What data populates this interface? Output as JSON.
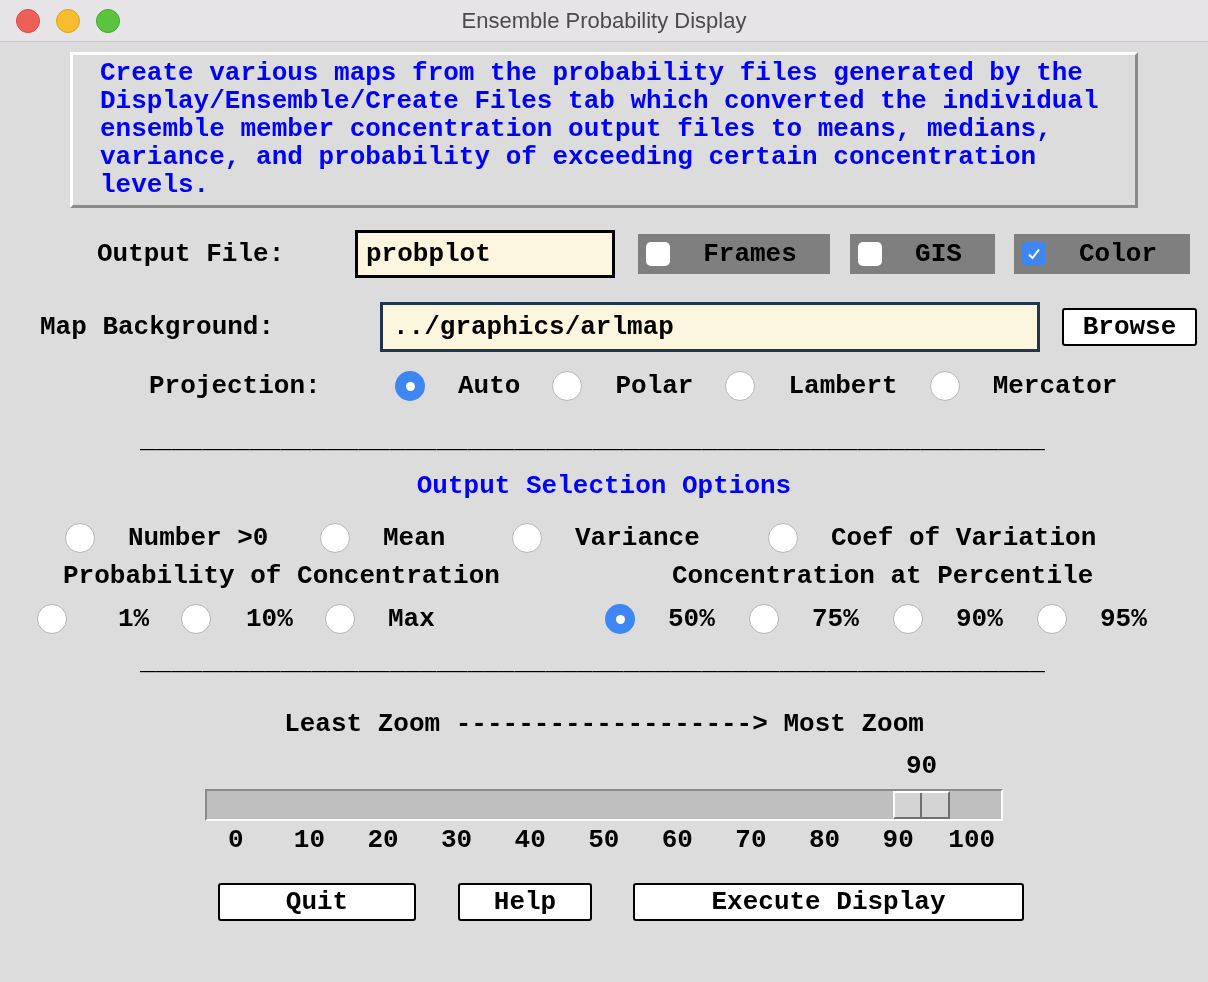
{
  "window": {
    "title": "Ensemble Probability Display"
  },
  "description": "Create various maps from the probability files generated by the Display/Ensemble/Create Files tab which converted the individual ensemble member concentration output files to means, medians, variance, and probability of exceeding certain concentration levels.",
  "output_file": {
    "label": "Output File:",
    "value": "probplot"
  },
  "toggles": [
    {
      "label": "Frames",
      "checked": false
    },
    {
      "label": "GIS",
      "checked": false
    },
    {
      "label": "Color",
      "checked": true
    }
  ],
  "map_background": {
    "label": "Map Background:",
    "value": "../graphics/arlmap",
    "button": "Browse"
  },
  "projection": {
    "label": "Projection:",
    "options": [
      {
        "label": "Auto",
        "selected": true
      },
      {
        "label": "Polar",
        "selected": false
      },
      {
        "label": "Lambert",
        "selected": false
      },
      {
        "label": "Mercator",
        "selected": false
      }
    ]
  },
  "divider_top": "__________________________________________________________",
  "output_section": {
    "title": "Output Selection Options",
    "statistics": [
      {
        "label": "Number >0",
        "selected": false
      },
      {
        "label": "Mean",
        "selected": false
      },
      {
        "label": "Variance",
        "selected": false
      },
      {
        "label": "Coef of Variation",
        "selected": false
      }
    ],
    "probability": {
      "label": "Probability of Concentration",
      "options": [
        {
          "label": "1%",
          "selected": false
        },
        {
          "label": "10%",
          "selected": false
        },
        {
          "label": "Max",
          "selected": false
        }
      ]
    },
    "percentile": {
      "label": "Concentration at Percentile",
      "options": [
        {
          "label": "50%",
          "selected": true
        },
        {
          "label": "75%",
          "selected": false
        },
        {
          "label": "90%",
          "selected": false
        },
        {
          "label": "95%",
          "selected": false
        }
      ]
    }
  },
  "divider_bottom": "__________________________________________________________",
  "zoom": {
    "label": "Least Zoom -------------------> Most Zoom",
    "reading": "90",
    "level": 0.9,
    "ticks": [
      "0",
      "10",
      "20",
      "30",
      "40",
      "50",
      "60",
      "70",
      "80",
      "90",
      "100"
    ]
  },
  "buttons": [
    "Quit",
    "Help",
    "Execute Display"
  ]
}
